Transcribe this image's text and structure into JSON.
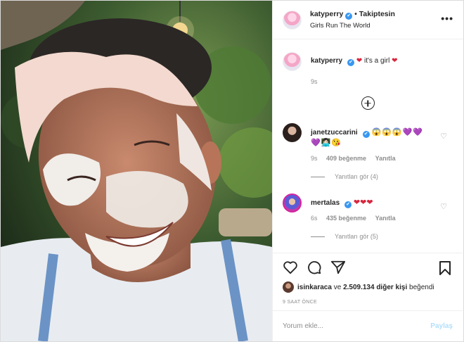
{
  "header": {
    "username": "katyperry",
    "verified_mark": "✔",
    "separator": "•",
    "follow_status": "Takiptesin",
    "subtitle": "Girls Run The World",
    "more": "•••"
  },
  "caption": {
    "username": "katyperry",
    "heart": "❤",
    "text": "it's a girl",
    "heart2": "❤",
    "time": "9s"
  },
  "comments": [
    {
      "username": "janetzuccarini",
      "text": "😱😱😱💜💜",
      "text2": "💜👩🏻‍💻😘",
      "time": "9s",
      "likes": "409 beğenme",
      "reply": "Yanıtla",
      "view_replies": "Yanıtları gör (4)"
    },
    {
      "username": "mertalas",
      "text": "❤❤❤",
      "time": "6s",
      "likes": "435 beğenme",
      "reply": "Yanıtla",
      "view_replies": "Yanıtları gör (5)"
    }
  ],
  "likes": {
    "user": "isinkaraca",
    "connector": "ve",
    "count_text": "2.509.134 diğer kişi",
    "suffix": "beğendi"
  },
  "timeago": "9 SAAT ÖNCE",
  "add_comment": {
    "placeholder": "Yorum ekle...",
    "share": "Paylaş"
  },
  "icons": [
    "heart-icon",
    "comment-icon",
    "share-icon",
    "bookmark-icon",
    "more-icon",
    "add-circle-icon"
  ],
  "colors": {
    "verified": "#3897f0",
    "muted": "#8e8e8e",
    "share_disabled": "#b2dffc",
    "text": "#262626"
  }
}
